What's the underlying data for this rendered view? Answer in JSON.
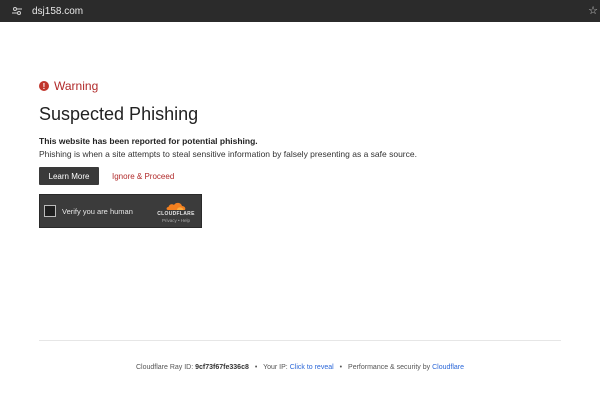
{
  "browser": {
    "url": "dsj158.com"
  },
  "page": {
    "warning_label": "Warning",
    "title": "Suspected Phishing",
    "desc_strong": "This website has been reported for potential phishing.",
    "desc": "Phishing is when a site attempts to steal sensitive information by falsely presenting as a safe source.",
    "learn_more": "Learn More",
    "ignore": "Ignore & Proceed"
  },
  "captcha": {
    "label": "Verify you are human",
    "brand": "CLOUDFLARE",
    "links": "Privacy • Help"
  },
  "footer": {
    "ray_prefix": "Cloudflare Ray ID:",
    "ray_id": "9cf73f67fe336c8",
    "ip_prefix": "Your IP:",
    "ip_link": "Click to reveal",
    "perf_prefix": "Performance & security by",
    "perf_link": "Cloudflare",
    "sep": "•"
  },
  "colors": {
    "accent_red": "#b12a2a",
    "link_blue": "#2b67d8",
    "cloudflare_orange": "#f38020"
  },
  "icons": {
    "site_info": "site-info-icon",
    "warning": "warning-icon",
    "star": "bookmark-star-icon",
    "cloudflare": "cloudflare-logo-icon"
  }
}
